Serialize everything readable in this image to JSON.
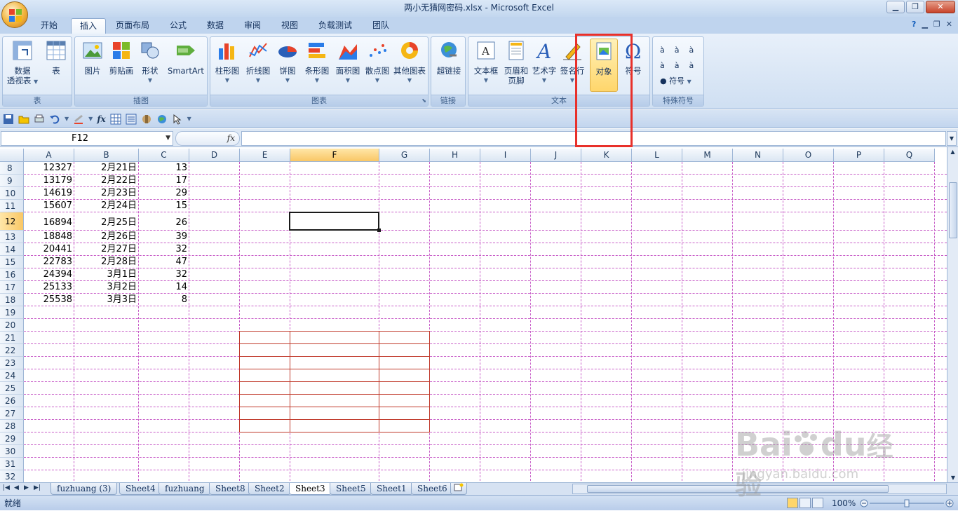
{
  "window": {
    "title": "两小无猜网密码.xlsx - Microsoft Excel",
    "minimize_label": "▁",
    "maximize_label": "❐",
    "close_label": "✕"
  },
  "ribbon_tabs": [
    {
      "label": "开始"
    },
    {
      "label": "插入"
    },
    {
      "label": "页面布局"
    },
    {
      "label": "公式"
    },
    {
      "label": "数据"
    },
    {
      "label": "审阅"
    },
    {
      "label": "视图"
    },
    {
      "label": "负载测试"
    },
    {
      "label": "团队"
    }
  ],
  "active_tab": "插入",
  "ribbon": {
    "groups": {
      "table": "表",
      "illustrations": "插图",
      "charts": "图表",
      "links": "链接",
      "text": "文本",
      "special": "特殊符号"
    },
    "buttons": {
      "pivot": "数据",
      "pivot2": "透视表",
      "table": "表",
      "picture": "图片",
      "clipart": "剪贴画",
      "shapes": "形状",
      "smartart": "SmartArt",
      "column": "柱形图",
      "line": "折线图",
      "pie": "饼图",
      "bar": "条形图",
      "area": "面积图",
      "scatter": "散点图",
      "other": "其他图表",
      "hyperlink": "超链接",
      "textbox": "文本框",
      "header": "页眉和",
      "header2": "页脚",
      "wordart": "艺术字",
      "signature": "签名行",
      "object": "对象",
      "symbol": "符号",
      "symbol2": "符号",
      "sym_a": "à"
    }
  },
  "formula_bar": {
    "name_box": "F12",
    "fx": "fx",
    "formula": ""
  },
  "columns": [
    "A",
    "B",
    "C",
    "D",
    "E",
    "F",
    "G",
    "H",
    "I",
    "J",
    "K",
    "L",
    "M",
    "N",
    "O",
    "P",
    "Q"
  ],
  "rows": [
    {
      "num": "8",
      "a": "12327",
      "b": "2月21日",
      "c": "13"
    },
    {
      "num": "9",
      "a": "13179",
      "b": "2月22日",
      "c": "17"
    },
    {
      "num": "10",
      "a": "14619",
      "b": "2月23日",
      "c": "29"
    },
    {
      "num": "11",
      "a": "15607",
      "b": "2月24日",
      "c": "15"
    },
    {
      "num": "12",
      "a": "16894",
      "b": "2月25日",
      "c": "26"
    },
    {
      "num": "13",
      "a": "18848",
      "b": "2月26日",
      "c": "39"
    },
    {
      "num": "14",
      "a": "20441",
      "b": "2月27日",
      "c": "32"
    },
    {
      "num": "15",
      "a": "22783",
      "b": "2月28日",
      "c": "47"
    },
    {
      "num": "16",
      "a": "24394",
      "b": "3月1日",
      "c": "32"
    },
    {
      "num": "17",
      "a": "25133",
      "b": "3月2日",
      "c": "14"
    },
    {
      "num": "18",
      "a": "25538",
      "b": "3月3日",
      "c": "8"
    },
    {
      "num": "19",
      "a": "",
      "b": "",
      "c": ""
    },
    {
      "num": "20",
      "a": "",
      "b": "",
      "c": ""
    },
    {
      "num": "21",
      "a": "",
      "b": "",
      "c": ""
    },
    {
      "num": "22",
      "a": "",
      "b": "",
      "c": ""
    },
    {
      "num": "23",
      "a": "",
      "b": "",
      "c": ""
    },
    {
      "num": "24",
      "a": "",
      "b": "",
      "c": ""
    },
    {
      "num": "25",
      "a": "",
      "b": "",
      "c": ""
    },
    {
      "num": "26",
      "a": "",
      "b": "",
      "c": ""
    },
    {
      "num": "27",
      "a": "",
      "b": "",
      "c": ""
    },
    {
      "num": "28",
      "a": "",
      "b": "",
      "c": ""
    },
    {
      "num": "29",
      "a": "",
      "b": "",
      "c": ""
    },
    {
      "num": "30",
      "a": "",
      "b": "",
      "c": ""
    },
    {
      "num": "31",
      "a": "",
      "b": "",
      "c": ""
    },
    {
      "num": "32",
      "a": "",
      "b": "",
      "c": ""
    }
  ],
  "selected_column": "F",
  "selected_row": "12",
  "sheet_tabs": [
    {
      "label": "fuzhuang (3)"
    },
    {
      "label": "Sheet4"
    },
    {
      "label": "fuzhuang"
    },
    {
      "label": "Sheet8"
    },
    {
      "label": "Sheet2"
    },
    {
      "label": "Sheet3"
    },
    {
      "label": "Sheet5"
    },
    {
      "label": "Sheet1"
    },
    {
      "label": "Sheet6"
    }
  ],
  "active_sheet": "Sheet3",
  "status": {
    "ready": "就绪",
    "zoom": "100%"
  },
  "watermark": {
    "brand": "Bai",
    "brand_mark": "du",
    "brand_suffix": "经验",
    "url": "jingyan.baidu.com"
  }
}
